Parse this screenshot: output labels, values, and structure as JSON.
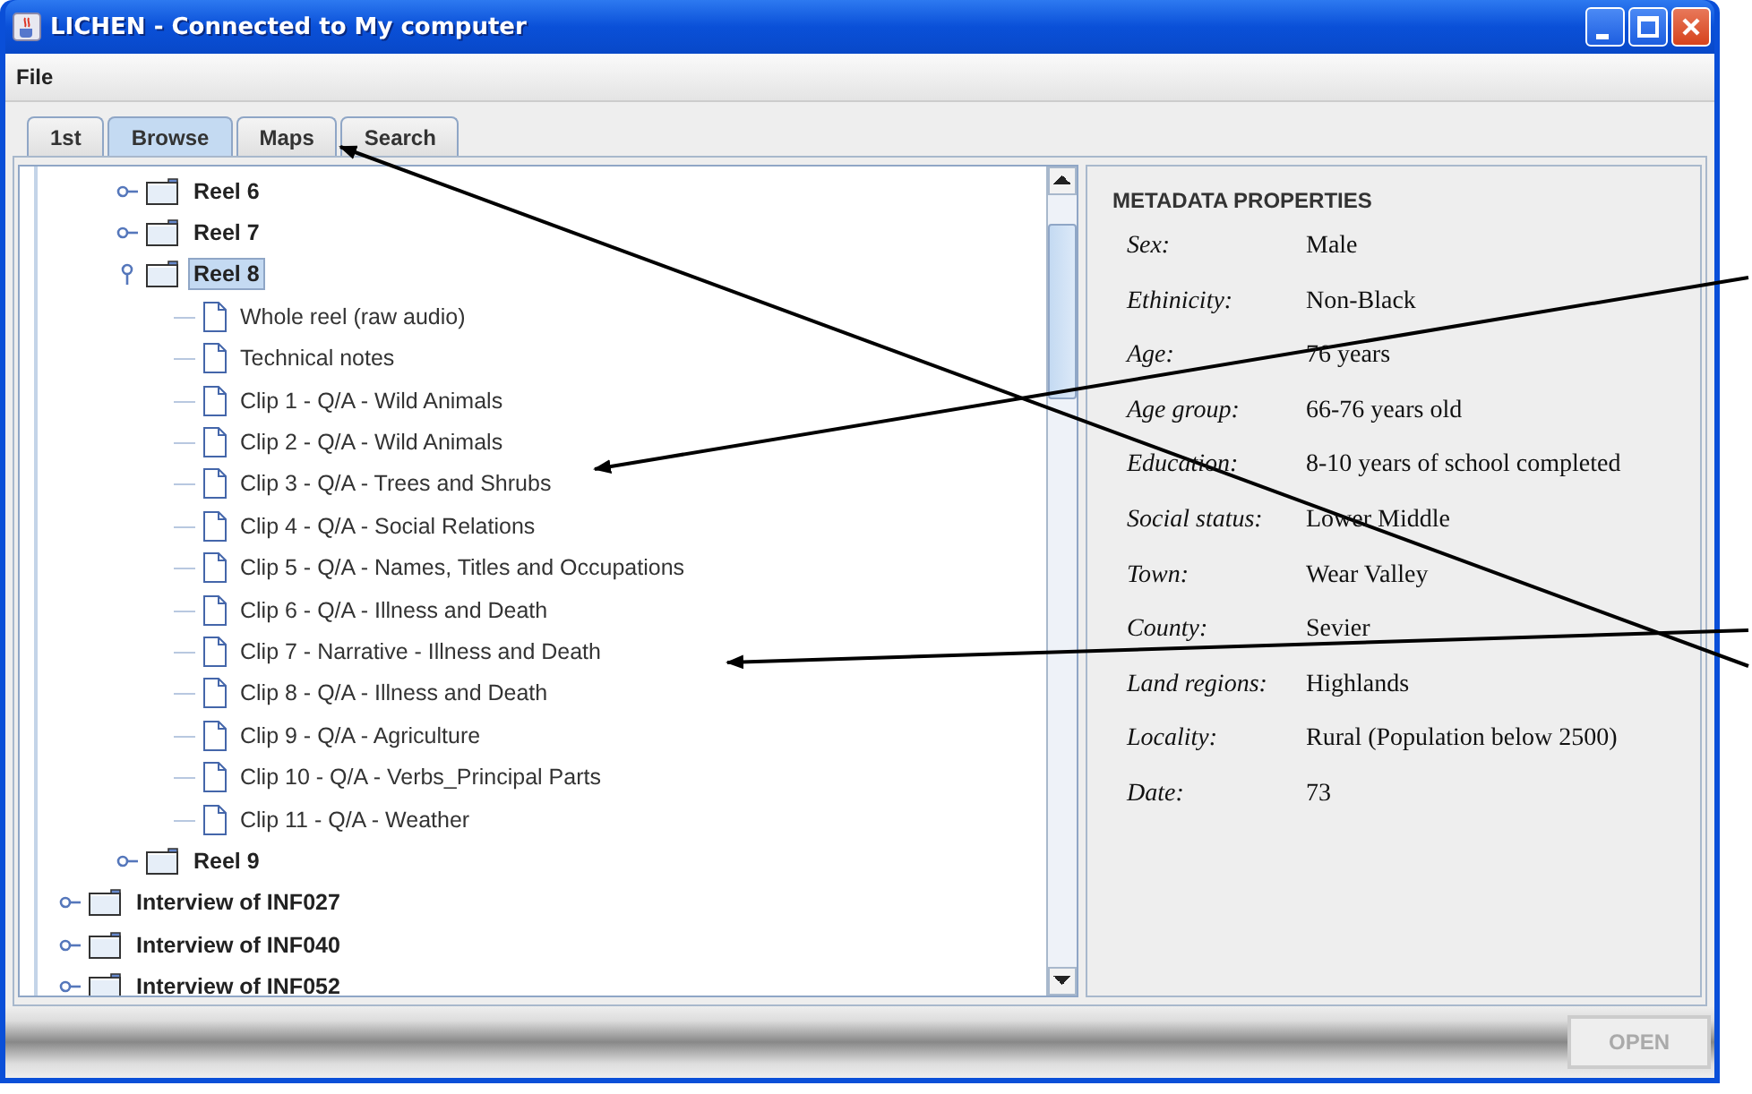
{
  "window": {
    "title": "LICHEN - Connected to My computer"
  },
  "menu": [
    "File"
  ],
  "tabs": [
    {
      "label": "1st",
      "selected": false
    },
    {
      "label": "Browse",
      "selected": true
    },
    {
      "label": "Maps",
      "selected": false
    },
    {
      "label": "Search",
      "selected": false
    }
  ],
  "tree": {
    "nested_items": [
      {
        "label": "Reel 6",
        "kind": "folder",
        "expanded": false,
        "selected": false
      },
      {
        "label": "Reel 7",
        "kind": "folder",
        "expanded": false,
        "selected": false
      },
      {
        "label": "Reel 8",
        "kind": "folder",
        "expanded": true,
        "selected": true,
        "children": [
          {
            "label": "Whole reel (raw audio)",
            "kind": "file",
            "selected": false
          },
          {
            "label": "Technical notes",
            "kind": "file",
            "selected": false
          },
          {
            "label": "Clip 1 - Q/A - Wild Animals",
            "kind": "file",
            "selected": false
          },
          {
            "label": "Clip 2 - Q/A - Wild Animals",
            "kind": "file",
            "selected": false
          },
          {
            "label": "Clip 3 - Q/A - Trees and Shrubs",
            "kind": "file",
            "selected": false
          },
          {
            "label": "Clip 4 - Q/A - Social Relations",
            "kind": "file",
            "selected": false
          },
          {
            "label": "Clip 5 - Q/A - Names, Titles and Occupations",
            "kind": "file",
            "selected": false
          },
          {
            "label": "Clip 6 - Q/A - Illness and Death",
            "kind": "file",
            "selected": false
          },
          {
            "label": "Clip 7 - Narrative - Illness and Death",
            "kind": "file",
            "selected": false
          },
          {
            "label": "Clip 8 - Q/A - Illness and Death",
            "kind": "file",
            "selected": false
          },
          {
            "label": "Clip 9 - Q/A - Agriculture",
            "kind": "file",
            "selected": false
          },
          {
            "label": "Clip 10 - Q/A - Verbs_Principal Parts",
            "kind": "file",
            "selected": false
          },
          {
            "label": "Clip 11 - Q/A - Weather",
            "kind": "file",
            "selected": false
          }
        ]
      },
      {
        "label": "Reel 9",
        "kind": "folder",
        "expanded": false,
        "selected": false
      }
    ],
    "root_items": [
      {
        "label": "Interview of INF027",
        "kind": "folder",
        "expanded": false,
        "selected": false
      },
      {
        "label": "Interview of INF040",
        "kind": "folder",
        "expanded": false,
        "selected": false
      },
      {
        "label": "Interview of INF052",
        "kind": "folder",
        "expanded": false,
        "selected": false
      }
    ]
  },
  "metadata": {
    "heading": "METADATA PROPERTIES",
    "properties": [
      {
        "label": "Sex:",
        "value": "Male"
      },
      {
        "label": "Ethinicity:",
        "value": "Non-Black"
      },
      {
        "label": "Age:",
        "value": "76 years"
      },
      {
        "label": "Age group:",
        "value": "66-76 years old"
      },
      {
        "label": "Education:",
        "value": "8-10 years of school completed"
      },
      {
        "label": "Social status:",
        "value": "Lower Middle"
      },
      {
        "label": "Town:",
        "value": "Wear Valley"
      },
      {
        "label": "County:",
        "value": "Sevier"
      },
      {
        "label": "Land regions:",
        "value": "Highlands"
      },
      {
        "label": "Locality:",
        "value": "Rural (Population below 2500)"
      },
      {
        "label": "Date:",
        "value": "73"
      }
    ]
  },
  "open_button": {
    "label": "OPEN",
    "disabled": true
  }
}
